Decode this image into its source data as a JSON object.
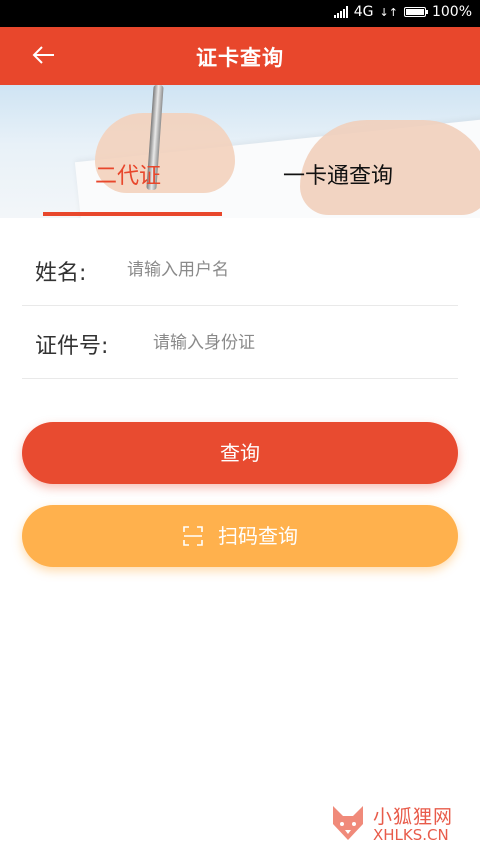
{
  "status": {
    "network": "4G",
    "battery": "100%",
    "battery_level": 1.0
  },
  "appbar": {
    "title": "证卡查询",
    "back_icon": "back-arrow-icon"
  },
  "tabs": [
    {
      "label": "二代证",
      "active": true
    },
    {
      "label": "一卡通查询",
      "active": false
    }
  ],
  "form": {
    "name": {
      "label": "姓名:",
      "placeholder": "请输入用户名",
      "value": ""
    },
    "id": {
      "label": "证件号:",
      "placeholder": "请输入身份证",
      "value": ""
    }
  },
  "buttons": {
    "query": "查询",
    "scan": "扫码查询",
    "scan_icon": "scan-icon"
  },
  "watermark": {
    "cn": "小狐狸网",
    "en": "XHLKS.CN"
  },
  "colors": {
    "primary": "#e8472c",
    "secondary": "#ffb14d"
  }
}
